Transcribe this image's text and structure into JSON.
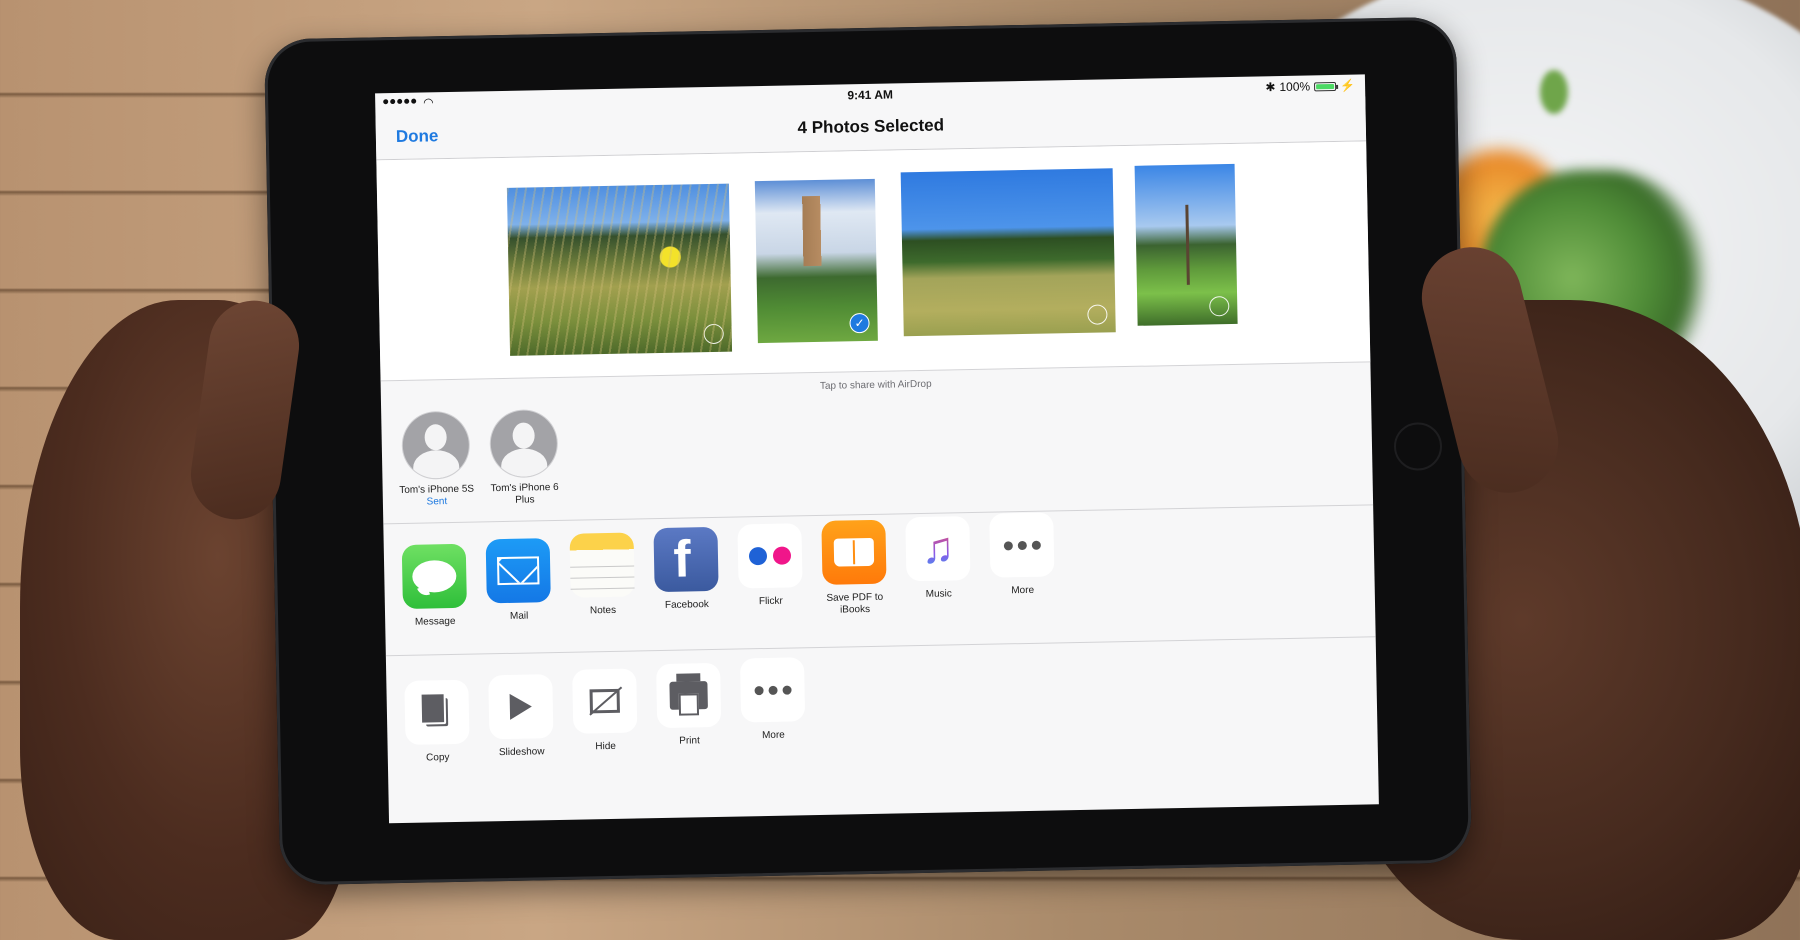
{
  "status_bar": {
    "signal_dots": 5,
    "clock": "9:41 AM",
    "bluetooth_icon": "bluetooth-icon",
    "battery_percent": "100%",
    "battery_level": 1.0
  },
  "nav": {
    "done_label": "Done",
    "title": "4 Photos Selected"
  },
  "photos": [
    {
      "description": "meadow with yellow flower",
      "selected": false
    },
    {
      "description": "stone tower with trees",
      "selected": true
    },
    {
      "description": "grassy field under blue sky",
      "selected": false
    },
    {
      "description": "bare tree in field",
      "selected": false
    }
  ],
  "airdrop": {
    "hint": "Tap to share with AirDrop",
    "devices": [
      {
        "name": "Tom's iPhone 5S",
        "status": "Sent"
      },
      {
        "name": "Tom's iPhone 6 Plus",
        "status": ""
      }
    ]
  },
  "share_apps": [
    {
      "label": "Message",
      "icon": "message-icon"
    },
    {
      "label": "Mail",
      "icon": "mail-icon"
    },
    {
      "label": "Notes",
      "icon": "notes-icon"
    },
    {
      "label": "Facebook",
      "icon": "facebook-icon",
      "glyph": "f"
    },
    {
      "label": "Flickr",
      "icon": "flickr-icon"
    },
    {
      "label": "Save PDF to iBooks",
      "icon": "ibooks-icon"
    },
    {
      "label": "Music",
      "icon": "music-icon",
      "glyph": "♫"
    },
    {
      "label": "More",
      "icon": "more-icon"
    }
  ],
  "actions": [
    {
      "label": "Copy",
      "icon": "copy-icon"
    },
    {
      "label": "Slideshow",
      "icon": "play-icon"
    },
    {
      "label": "Hide",
      "icon": "hide-icon"
    },
    {
      "label": "Print",
      "icon": "print-icon"
    },
    {
      "label": "More",
      "icon": "more-icon"
    }
  ],
  "colors": {
    "accent": "#1f7ae0",
    "battery": "#4cd964"
  }
}
